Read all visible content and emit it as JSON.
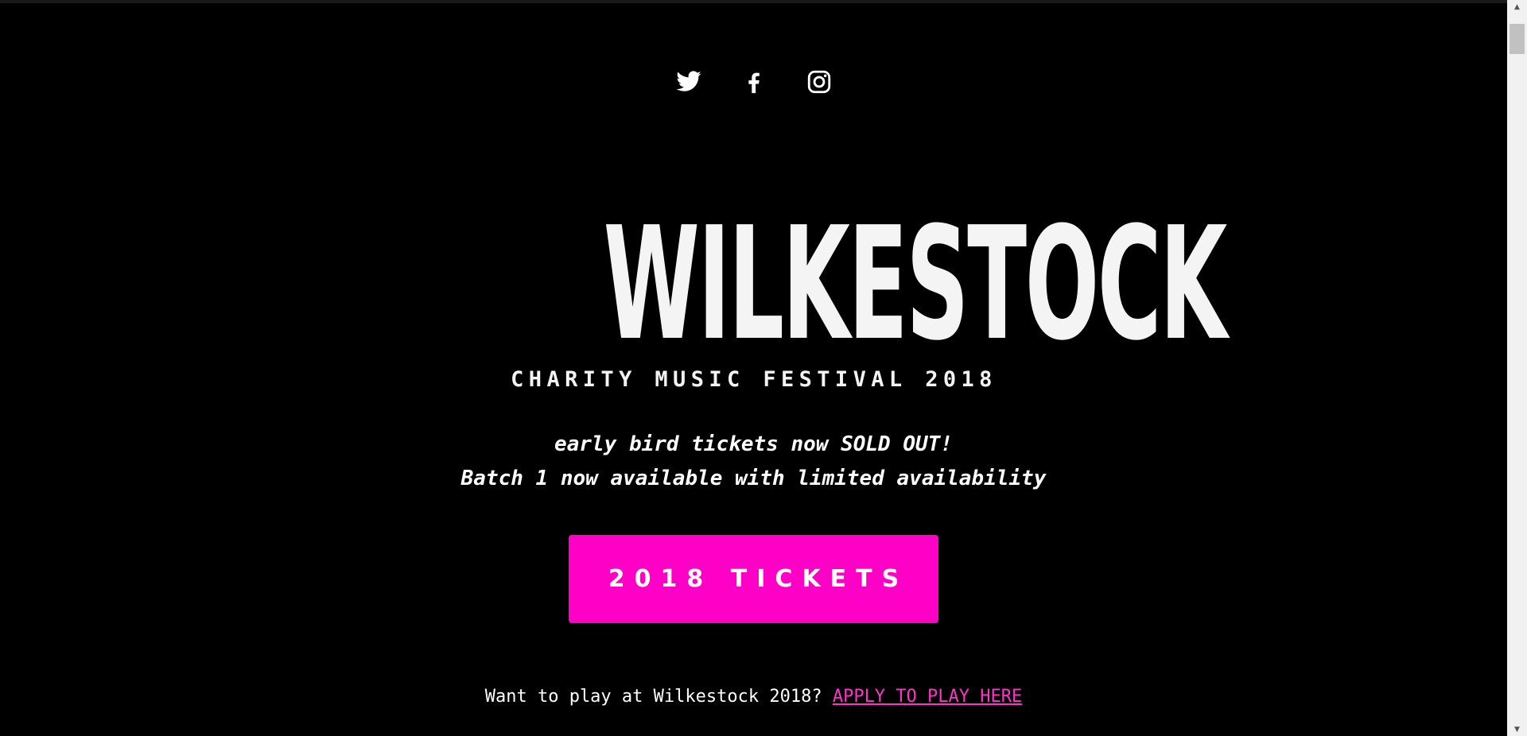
{
  "social": {
    "twitter_icon": "twitter-icon",
    "facebook_icon": "facebook-icon",
    "instagram_icon": "instagram-icon"
  },
  "logo": {
    "title": "WILKESTOCK",
    "subtitle": "CHARITY MUSIC FESTIVAL 2018"
  },
  "notice": {
    "line1": "early bird tickets now SOLD OUT!",
    "line2": "Batch 1 now available with limited availability"
  },
  "tickets_button": {
    "label": "2018 TICKETS"
  },
  "apply": {
    "prompt": "Want to play at Wilkestock 2018? ",
    "link_label": "APPLY TO PLAY HERE"
  },
  "scrollbar": {
    "up_icon": "▲",
    "down_icon": "▼"
  },
  "colors": {
    "background": "#000000",
    "accent": "#ff00c7",
    "link": "#ff33cc",
    "text": "#ffffff"
  }
}
